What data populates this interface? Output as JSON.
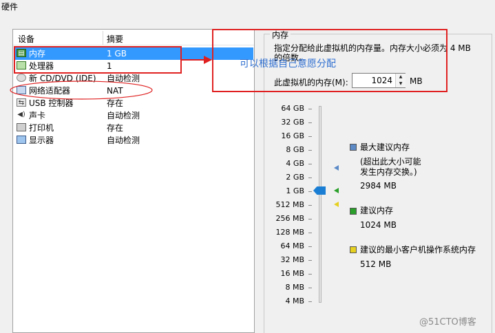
{
  "window": {
    "title": "硬件"
  },
  "device_list": {
    "headers": {
      "device": "设备",
      "summary": "摘要"
    },
    "rows": [
      {
        "name": "内存",
        "summary": "1 GB",
        "icon": "memory-icon",
        "selected": true
      },
      {
        "name": "处理器",
        "summary": "1",
        "icon": "processor-icon",
        "selected": false
      },
      {
        "name": "新 CD/DVD (IDE)",
        "summary": "自动检测",
        "icon": "cd-dvd-icon",
        "selected": false
      },
      {
        "name": "网络适配器",
        "summary": "NAT",
        "icon": "network-adapter-icon",
        "selected": false
      },
      {
        "name": "USB 控制器",
        "summary": "存在",
        "icon": "usb-icon",
        "selected": false
      },
      {
        "name": "声卡",
        "summary": "自动检测",
        "icon": "sound-card-icon",
        "selected": false
      },
      {
        "name": "打印机",
        "summary": "存在",
        "icon": "printer-icon",
        "selected": false
      },
      {
        "name": "显示器",
        "summary": "自动检测",
        "icon": "display-icon",
        "selected": false
      }
    ]
  },
  "memory": {
    "group_title": "内存",
    "description": "指定分配给此虚拟机的内存量。内存大小必须为 4 MB 的倍数。",
    "field_label": "此虚拟机的内存(M):",
    "value": "1024",
    "unit": "MB",
    "scale_labels": [
      "64 GB",
      "32 GB",
      "16 GB",
      "8 GB",
      "4 GB",
      "2 GB",
      "1 GB",
      "512 MB",
      "256 MB",
      "128 MB",
      "64 MB",
      "32 MB",
      "16 MB",
      "8 MB",
      "4 MB"
    ],
    "legend": {
      "max": {
        "title": "最大建议内存",
        "note_line1": "(超出此大小可能",
        "note_line2": "发生内存交换。)",
        "value": "2984 MB",
        "color": "#5b8ac7"
      },
      "recommended": {
        "title": "建议内存",
        "value": "1024 MB",
        "color": "#2aa02a"
      },
      "min_guest": {
        "title": "建议的最小客户机操作系统内存",
        "value": "512 MB",
        "color": "#e6d020"
      }
    }
  },
  "annotation": {
    "text": "可以根据自己意愿分配",
    "color": "#e02020"
  },
  "watermark": {
    "text": "@51CTO博客"
  }
}
